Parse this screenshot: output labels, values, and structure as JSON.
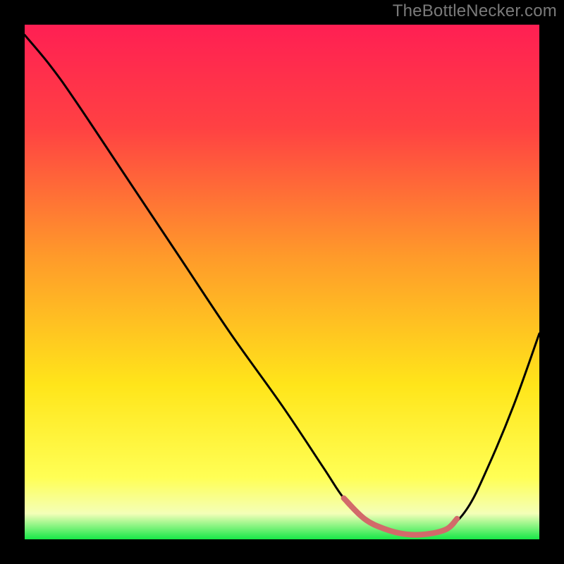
{
  "watermark": "TheBottleNecker.com",
  "chart_data": {
    "type": "line",
    "title": "",
    "xlabel": "",
    "ylabel": "",
    "xlim": [
      0,
      100
    ],
    "ylim": [
      0,
      100
    ],
    "gradient_stops": [
      {
        "offset": 0,
        "color": "#ff1f53"
      },
      {
        "offset": 20,
        "color": "#ff4143"
      },
      {
        "offset": 45,
        "color": "#ff9a2a"
      },
      {
        "offset": 70,
        "color": "#ffe51a"
      },
      {
        "offset": 88,
        "color": "#ffff55"
      },
      {
        "offset": 95,
        "color": "#f4ffb8"
      },
      {
        "offset": 100,
        "color": "#17e847"
      }
    ],
    "series": [
      {
        "name": "bottleneck-curve",
        "x": [
          0,
          5,
          10,
          20,
          30,
          40,
          50,
          58,
          62,
          66,
          70,
          74,
          78,
          82,
          86,
          90,
          95,
          100
        ],
        "values": [
          98,
          92,
          85,
          70,
          55,
          40,
          26,
          14,
          8,
          4,
          2,
          1,
          1,
          2,
          6,
          14,
          26,
          40
        ]
      }
    ],
    "highlight": {
      "name": "valley-highlight",
      "color": "#d26a6a",
      "x": [
        62,
        66,
        70,
        74,
        78,
        82,
        84
      ],
      "values": [
        8,
        4,
        2,
        1,
        1,
        2,
        4
      ]
    }
  }
}
